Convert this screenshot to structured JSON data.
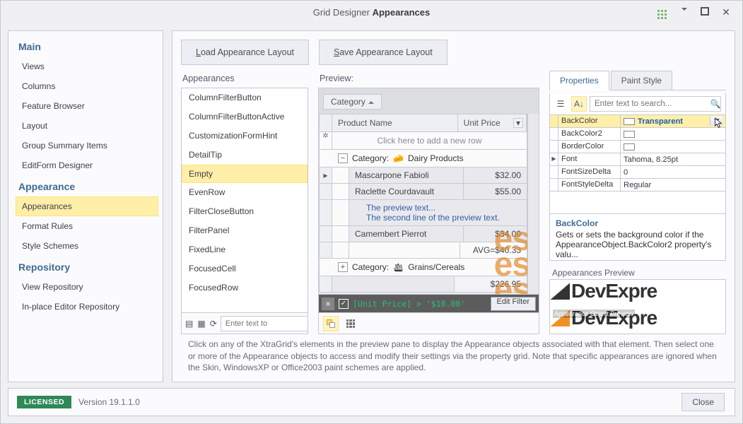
{
  "title_prefix": "Grid Designer",
  "title_suffix": "Appearances",
  "nav": {
    "sections": [
      {
        "title": "Main",
        "items": [
          "Views",
          "Columns",
          "Feature Browser",
          "Layout",
          "Group Summary Items",
          "EditForm Designer"
        ]
      },
      {
        "title": "Appearance",
        "items": [
          "Appearances",
          "Format Rules",
          "Style Schemes"
        ],
        "selected_index": 0
      },
      {
        "title": "Repository",
        "items": [
          "View Repository",
          "In-place Editor Repository"
        ]
      }
    ]
  },
  "top": {
    "load_btn": "Load Appearance Layout",
    "save_btn": "Save Appearance Layout",
    "load_key": "L",
    "save_key": "S"
  },
  "appr": {
    "label": "Appearances",
    "items": [
      "ColumnFilterButton",
      "ColumnFilterButtonActive",
      "CustomizationFormHint",
      "DetailTip",
      "Empty",
      "EvenRow",
      "FilterCloseButton",
      "FilterPanel",
      "FixedLine",
      "FocusedCell",
      "FocusedRow"
    ],
    "selected_index": 4,
    "search_placeholder": "Enter text to"
  },
  "preview": {
    "label": "Preview:",
    "group_header": "Category",
    "col_name": "Product Name",
    "col_price": "Unit Price",
    "newrow": "Click here to add a new row",
    "group1_title": "Category:",
    "group1_value": "Dairy Products",
    "rows1": [
      {
        "name": "Mascarpone Fabioli",
        "price": "$32.00"
      },
      {
        "name": "Raclette Courdavault",
        "price": "$55.00"
      }
    ],
    "preview_line1": "The preview text...",
    "preview_line2": "The second line of the preview text.",
    "row3": {
      "name": "Camembert Pierrot",
      "price": "$34.00"
    },
    "group_summary": "AVG=$40.33",
    "group2_title": "Category:",
    "group2_value": "Grains/Cereals",
    "footer_sum": "$226.95",
    "filter_expr": "[Unit Price] > '$10.00'",
    "edit_filter": "Edit Filter"
  },
  "props": {
    "tabs": [
      "Properties",
      "Paint Style"
    ],
    "active_tab": 0,
    "search_placeholder": "Enter text to search...",
    "rows": [
      {
        "key": "BackColor",
        "value": "Transparent",
        "swatch": "#ffffff",
        "selected": true
      },
      {
        "key": "BackColor2",
        "value": "",
        "swatch": "#ffffff"
      },
      {
        "key": "BorderColor",
        "value": "",
        "swatch": "#ffffff"
      },
      {
        "key": "Font",
        "value": "Tahoma, 8.25pt",
        "marker": ">"
      },
      {
        "key": "FontSizeDelta",
        "value": "0"
      },
      {
        "key": "FontStyleDelta",
        "value": "Regular"
      }
    ],
    "desc_title": "BackColor",
    "desc_body": "Gets or sets the background color if the AppearanceObject.BackColor2 property's valu..."
  },
  "appr_preview": {
    "title": "Appearances Preview",
    "brand": "DevExpre",
    "overlay": "Appearance Object Preview"
  },
  "help": "Click on any of the XtraGrid's elements in the preview pane to display the Appearance objects associated with that element. Then select one or more of the Appearance objects to access and modify their settings via the property grid. Note that specific appearances are ignored when the Skin, WindowsXP or Office2003 paint schemes are applied.",
  "status": {
    "licensed": "LICENSED",
    "version": "Version 19.1.1.0",
    "close": "Close"
  }
}
